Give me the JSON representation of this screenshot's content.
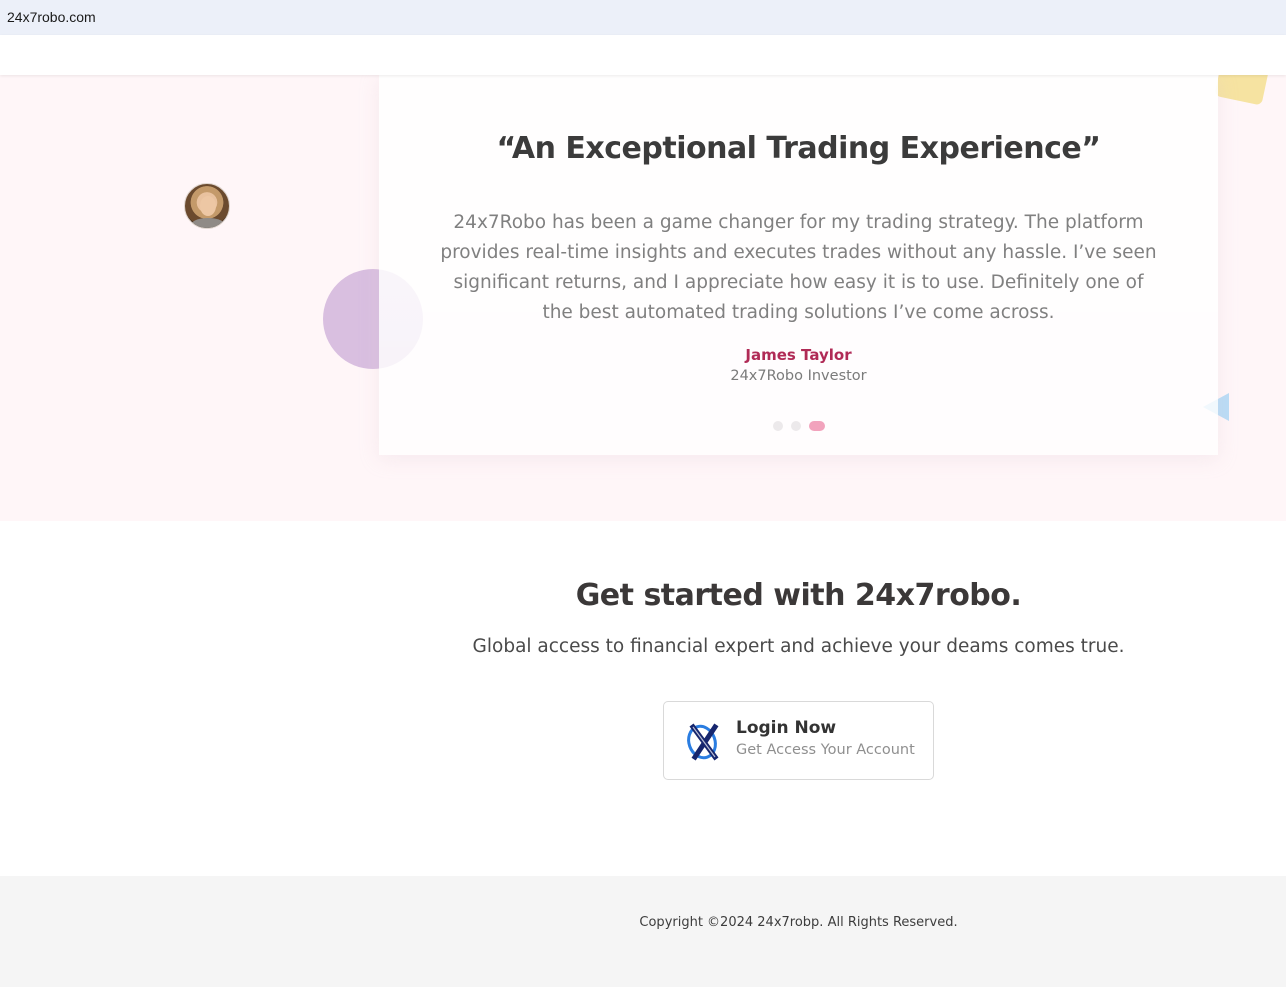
{
  "browser": {
    "url": "24x7robo.com"
  },
  "testimonial": {
    "title": "“An Exceptional Trading Experience”",
    "body": "24x7Robo has been a game changer for my trading strategy. The platform provides real-time insights and executes trades without any hassle. I’ve seen significant returns, and I appreciate how easy it is to use. Definitely one of the best automated trading solutions I’ve come across.",
    "author_name": "James Taylor",
    "author_role": "24x7Robo Investor",
    "slide_count": 3,
    "active_slide": 3,
    "colors": {
      "author_name": "#b02a56",
      "active_dot": "#f2a3bd"
    }
  },
  "cta": {
    "title": "Get started with 24x7robo.",
    "subtitle": "Global access to financial expert and achieve your deams comes true.",
    "login": {
      "title": "Login Now",
      "subtitle": "Get Access Your Account",
      "icon": "x-logo-icon"
    }
  },
  "footer": {
    "copyright": "Copyright ©2024 24x7robp. All Rights Reserved."
  }
}
